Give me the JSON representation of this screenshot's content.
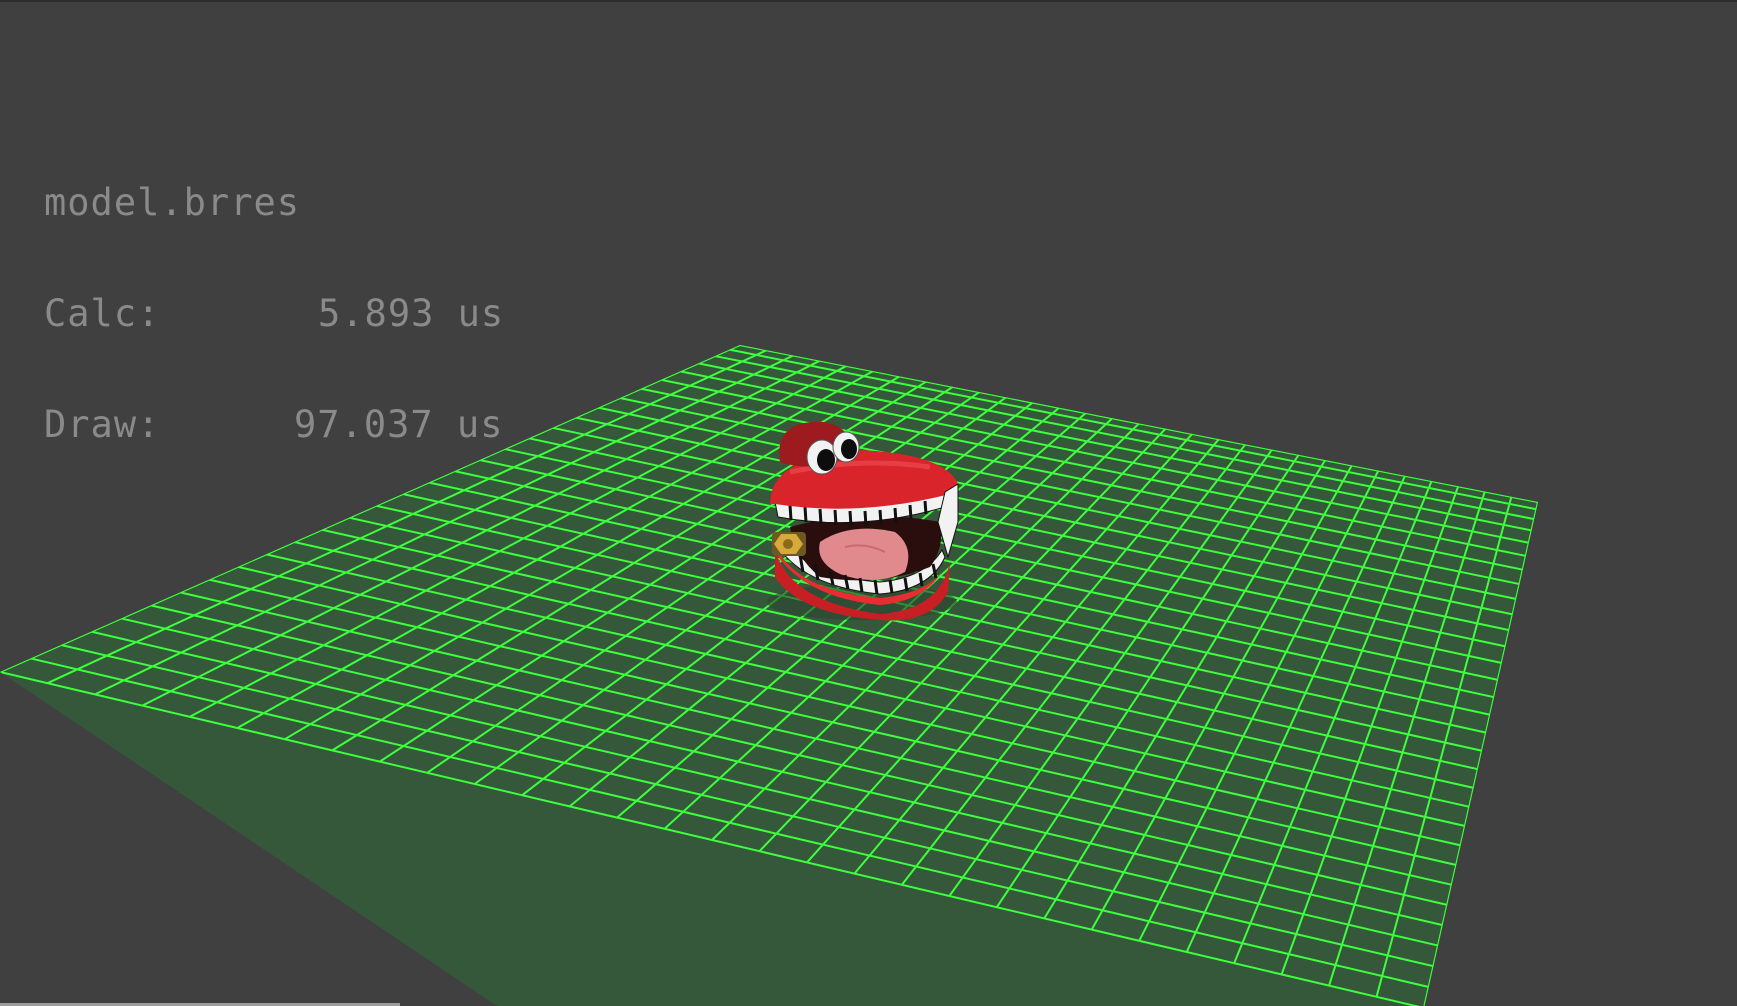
{
  "viewport": {
    "filename": "model.brres",
    "calc_label": "Calc:",
    "calc_value": "5.893 us",
    "draw_label": "Draw:",
    "draw_value": "97.037 us"
  },
  "colors": {
    "background": "#404040",
    "floor_fill": "#35573a",
    "grid_line": "#3dff3d",
    "text": "#8a8a8a",
    "model_red": "#d8242a",
    "teeth_white": "#f2f2f2",
    "tongue": "#e08a8e"
  },
  "grid": {
    "divisions": 30
  },
  "model": {
    "icon": "chattering-teeth-icon"
  }
}
